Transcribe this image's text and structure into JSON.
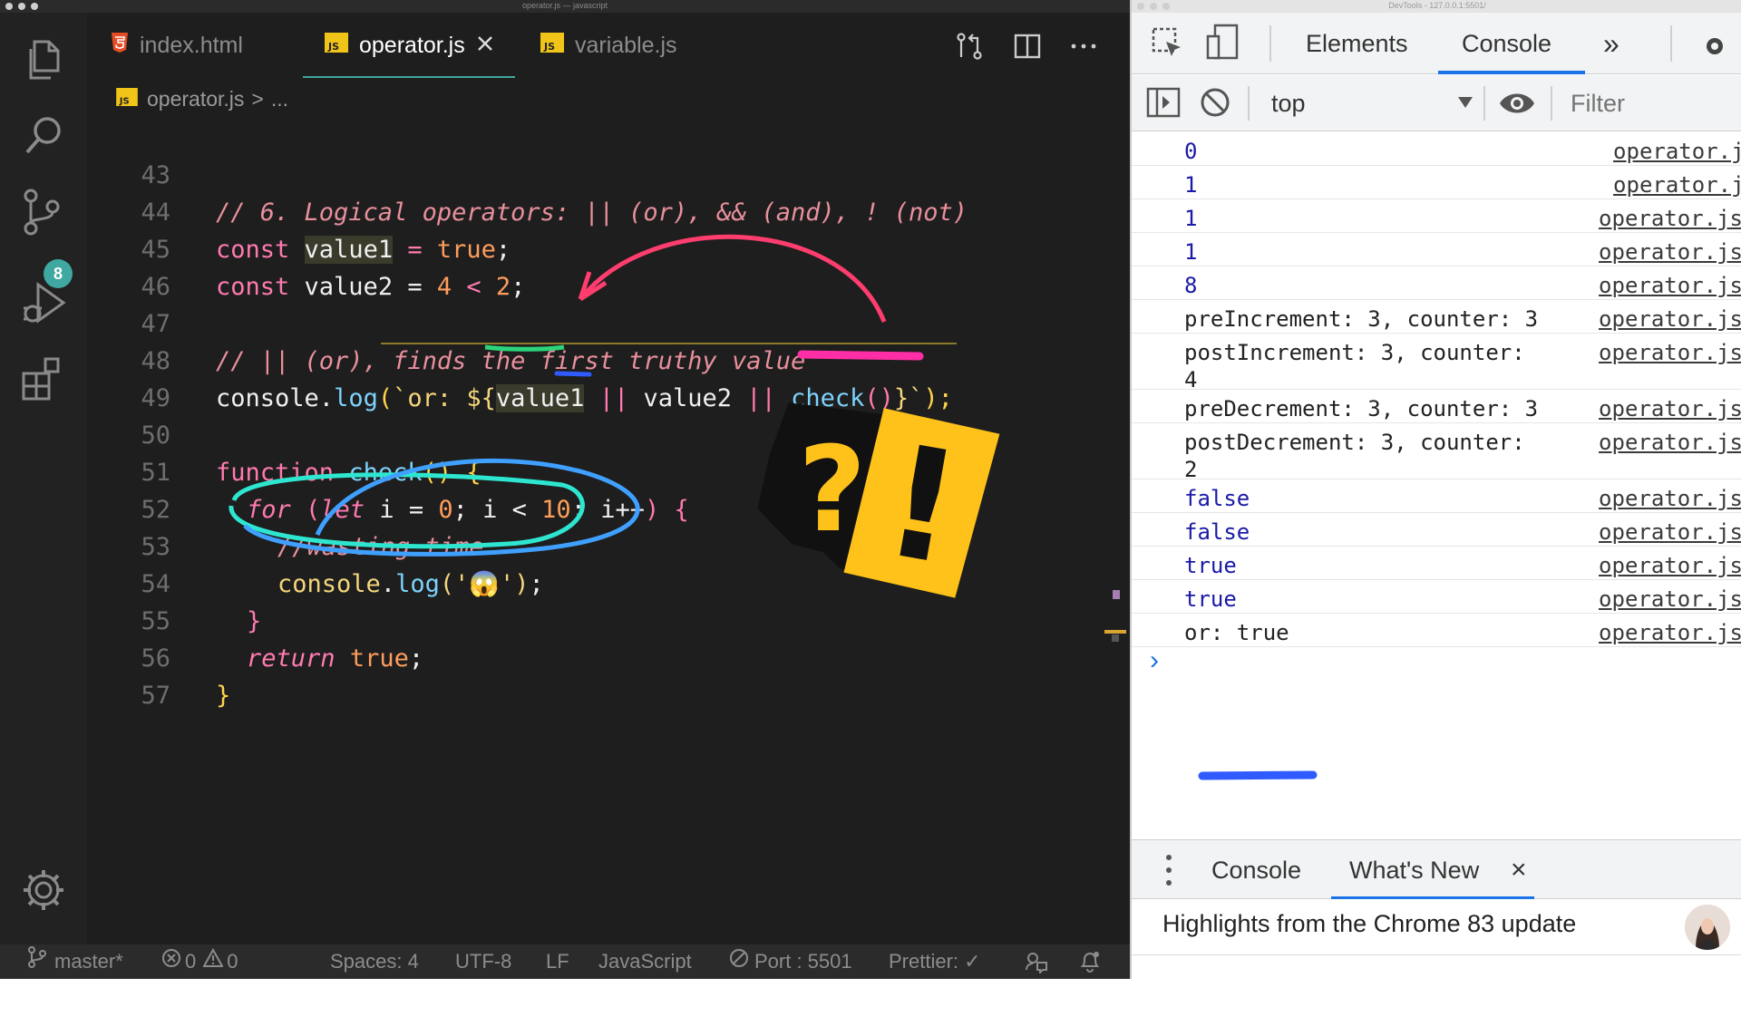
{
  "window": {
    "vscode_title": "operator.js — javascript",
    "devtools_title": "DevTools - 127.0.0.1:5501/"
  },
  "activity": {
    "scm_badge": "8"
  },
  "tabs": [
    {
      "label": "index.html",
      "icon": "html5-icon"
    },
    {
      "label": "operator.js",
      "icon": "js-file-icon"
    },
    {
      "label": "variable.js",
      "icon": "js-file-icon"
    }
  ],
  "breadcrumb": {
    "file": "operator.js",
    "sep": ">",
    "more": "..."
  },
  "editor": {
    "line_numbers": [
      "43",
      "44",
      "45",
      "46",
      "47",
      "48",
      "49",
      "50",
      "51",
      "52",
      "53",
      "54",
      "55",
      "56",
      "57"
    ],
    "line43": "// 6. Logical operators: || (or), && (and), ! (not)",
    "line44": {
      "kw": "const",
      "var": "value1",
      "eq": " = ",
      "val": "true",
      "end": ";"
    },
    "line45": {
      "kw": "const",
      "rest": " value2 = ",
      "num1": "4",
      "op": " < ",
      "num2": "2",
      "end": ";"
    },
    "line47": "// || (or), finds the first truthy value",
    "line48": {
      "obj": "console",
      "dot": ".",
      "fn": "log",
      "open": "(",
      "tpl_open": "`or: ${",
      "v1": "value1",
      "or1": " || ",
      "v2": "value2",
      "or2": " || ",
      "call": "check",
      "parens": "()",
      "tpl_close": "}`",
      "close": ");"
    },
    "line50": {
      "kw": "function",
      "fn": "check",
      "rest": "() {"
    },
    "line51": {
      "kw": "for",
      "open": " (",
      "let": "let",
      "mid1": " i = ",
      "n0": "0",
      "mid2": "; i < ",
      "n10": "10",
      "mid3": "; i++",
      "close": ")",
      "brace": " {"
    },
    "line52": "//wasting time",
    "line53": {
      "obj": "console",
      "dot": ".",
      "fn": "log",
      "arg": "('😱')",
      "end": ";"
    },
    "line54": "}",
    "line55": {
      "kw": "return",
      "val": "true",
      "end": ";"
    },
    "line56": "}"
  },
  "statusbar": {
    "branch": "master*",
    "errors": "0",
    "warnings": "0",
    "spaces": "Spaces: 4",
    "encoding": "UTF-8",
    "eol": "LF",
    "language": "JavaScript",
    "port": "Port : 5501",
    "prettier": "Prettier: ✓"
  },
  "devtools": {
    "tabs": {
      "elements": "Elements",
      "console": "Console",
      "more": "»"
    },
    "toolbar": {
      "context": "top",
      "filter_placeholder": "Filter"
    },
    "messages": [
      {
        "text": "0",
        "src": "operator.js"
      },
      {
        "text": "1",
        "src": "operator.js"
      },
      {
        "text": "1",
        "src": "operator.js"
      },
      {
        "text": "1",
        "src": "operator.js"
      },
      {
        "text": "8",
        "src": "operator.js"
      },
      {
        "text": "preIncrement: 3, counter: 3",
        "src": "operator.js"
      },
      {
        "text": "postIncrement: 3, counter:\n4",
        "src": "operator.js"
      },
      {
        "text": "preDecrement: 3, counter: 3",
        "src": "operator.js"
      },
      {
        "text": "postDecrement: 3, counter:\n2",
        "src": "operator.js"
      },
      {
        "text": "false",
        "src": "operator.js"
      },
      {
        "text": "false",
        "src": "operator.js"
      },
      {
        "text": "true",
        "src": "operator.js"
      },
      {
        "text": "true",
        "src": "operator.js"
      },
      {
        "text": "or: true",
        "src": "operator.js"
      }
    ],
    "prompt": "›",
    "drawer": {
      "console_tab": "Console",
      "whats_new_tab": "What's New",
      "close": "×",
      "highlights": "Highlights from the Chrome 83 update"
    }
  },
  "sticker": {
    "text1": "?",
    "text2": "!"
  }
}
